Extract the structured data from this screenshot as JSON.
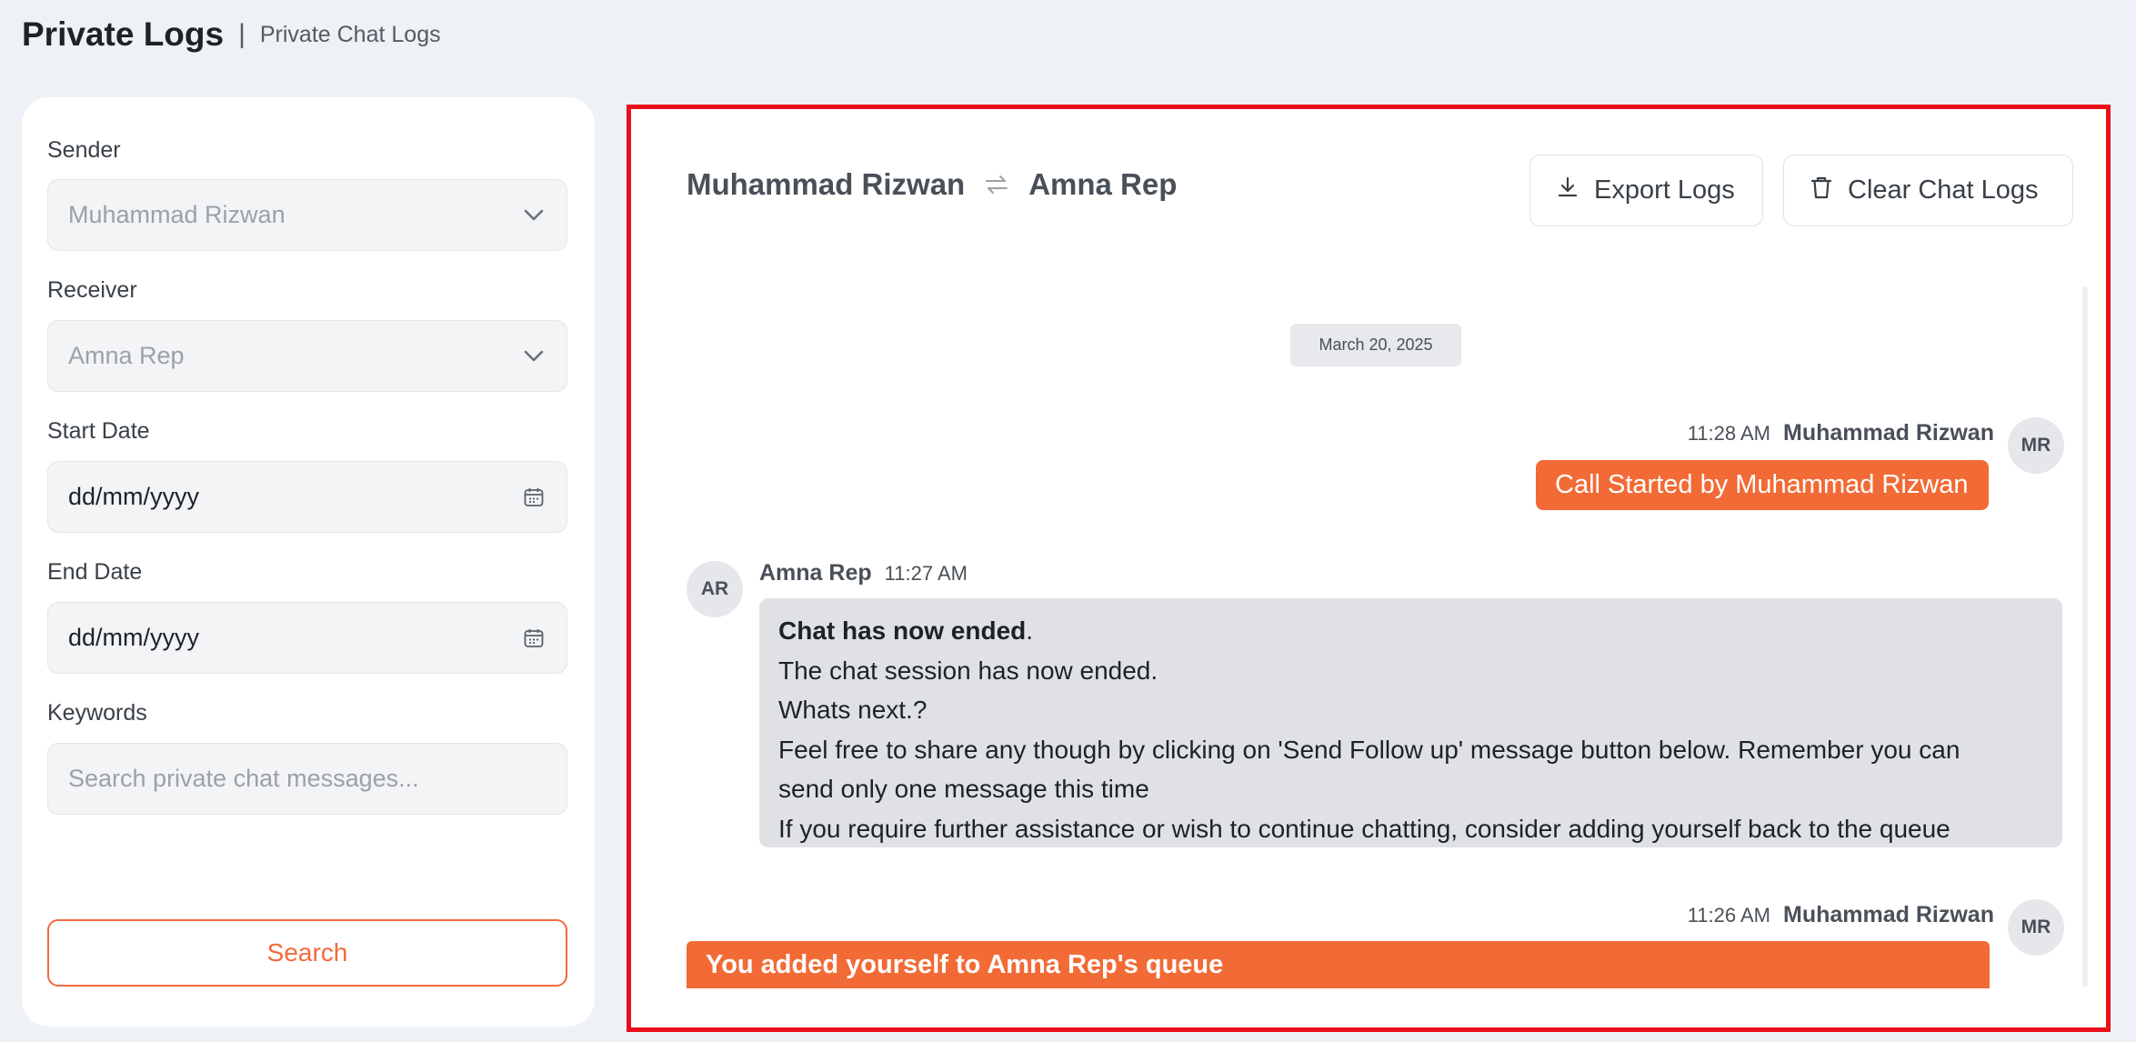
{
  "page": {
    "title": "Private Logs",
    "separator": "|",
    "subtitle": "Private Chat Logs"
  },
  "filters": {
    "sender_label": "Sender",
    "sender_value": "Muhammad Rizwan",
    "receiver_label": "Receiver",
    "receiver_value": "Amna Rep",
    "start_date_label": "Start Date",
    "start_date_value": "dd/mm/yyyy",
    "end_date_label": "End Date",
    "end_date_value": "dd/mm/yyyy",
    "keywords_label": "Keywords",
    "keywords_placeholder": "Search private chat messages...",
    "search_button": "Search"
  },
  "chat": {
    "participant_a": "Muhammad Rizwan",
    "participant_b": "Amna Rep",
    "export_button": "Export Logs",
    "clear_button": "Clear Chat Logs",
    "date_divider": "March 20, 2025",
    "messages": [
      {
        "time": "11:28 AM",
        "sender": "Muhammad Rizwan",
        "initials": "MR",
        "text": "Call Started by Muhammad Rizwan"
      },
      {
        "time": "11:27 AM",
        "sender": "Amna Rep",
        "initials": "AR",
        "lines": [
          "Chat has now ended",
          ".",
          "The chat session has now ended.",
          "Whats next.?",
          "Feel free to share any though by clicking on 'Send Follow up' message button below. Remember you can",
          "send only one message this time",
          "If you require further assistance or wish to continue chatting, consider adding yourself back to the queue"
        ]
      },
      {
        "time": "11:26 AM",
        "sender": "Muhammad Rizwan",
        "initials": "MR",
        "text": "You added yourself to Amna Rep's queue"
      }
    ]
  },
  "colors": {
    "accent_orange": "#f26a35",
    "highlight_border": "#e8101a",
    "background": "#eef1f5"
  },
  "icons": [
    "chevron-down-icon",
    "calendar-icon",
    "swap-arrows-icon",
    "download-icon",
    "trash-icon"
  ]
}
